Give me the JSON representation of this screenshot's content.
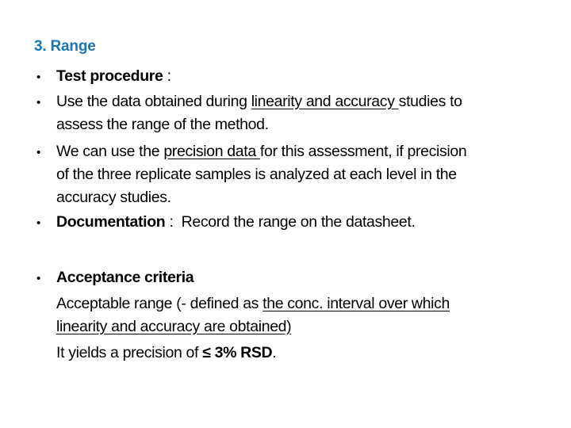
{
  "slide": {
    "title": "3. Range",
    "bullet_glyph": "•",
    "items": [
      {
        "label": "Test procedure",
        "label_suffix": " :"
      },
      {
        "lines": [
          {
            "pre": "Use the data obtained during ",
            "underlined": "linearity and accuracy ",
            "post": "studies to"
          },
          {
            "text": "assess the range of the method."
          }
        ]
      },
      {
        "lines": [
          {
            "pre": "We can use the ",
            "underlined": "precision data ",
            "post": "for this assessment, if precision"
          },
          {
            "text": "of the three replicate samples is analyzed at each level in the"
          },
          {
            "text": "accuracy studies."
          }
        ]
      },
      {
        "label": "Documentation",
        "label_suffix": " :  Record the range on the datasheet."
      },
      {
        "label": "Acceptance criteria",
        "sub_lines": [
          {
            "pre": "Acceptable range (- defined as ",
            "underlined": "the conc. interval over which"
          },
          {
            "underlined": "linearity and accuracy are obtained)"
          },
          {
            "pre": "It yields a precision of ",
            "bold": "≤ 3% RSD",
            "post": "."
          }
        ]
      }
    ]
  },
  "colors": {
    "title": "#1a75b5",
    "text": "#000000",
    "background": "#ffffff"
  }
}
